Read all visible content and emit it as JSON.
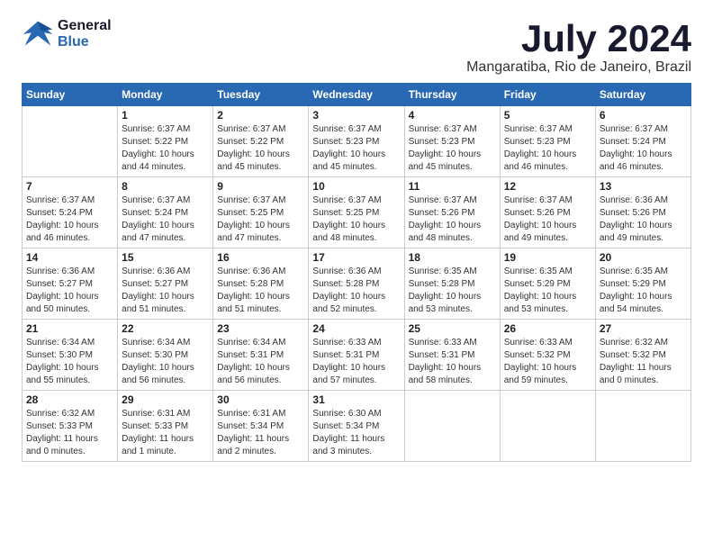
{
  "logo": {
    "line1": "General",
    "line2": "Blue"
  },
  "title": "July 2024",
  "subtitle": "Mangaratiba, Rio de Janeiro, Brazil",
  "headers": [
    "Sunday",
    "Monday",
    "Tuesday",
    "Wednesday",
    "Thursday",
    "Friday",
    "Saturday"
  ],
  "weeks": [
    [
      {
        "day": "",
        "info": ""
      },
      {
        "day": "1",
        "info": "Sunrise: 6:37 AM\nSunset: 5:22 PM\nDaylight: 10 hours\nand 44 minutes."
      },
      {
        "day": "2",
        "info": "Sunrise: 6:37 AM\nSunset: 5:22 PM\nDaylight: 10 hours\nand 45 minutes."
      },
      {
        "day": "3",
        "info": "Sunrise: 6:37 AM\nSunset: 5:23 PM\nDaylight: 10 hours\nand 45 minutes."
      },
      {
        "day": "4",
        "info": "Sunrise: 6:37 AM\nSunset: 5:23 PM\nDaylight: 10 hours\nand 45 minutes."
      },
      {
        "day": "5",
        "info": "Sunrise: 6:37 AM\nSunset: 5:23 PM\nDaylight: 10 hours\nand 46 minutes."
      },
      {
        "day": "6",
        "info": "Sunrise: 6:37 AM\nSunset: 5:24 PM\nDaylight: 10 hours\nand 46 minutes."
      }
    ],
    [
      {
        "day": "7",
        "info": "Sunrise: 6:37 AM\nSunset: 5:24 PM\nDaylight: 10 hours\nand 46 minutes."
      },
      {
        "day": "8",
        "info": "Sunrise: 6:37 AM\nSunset: 5:24 PM\nDaylight: 10 hours\nand 47 minutes."
      },
      {
        "day": "9",
        "info": "Sunrise: 6:37 AM\nSunset: 5:25 PM\nDaylight: 10 hours\nand 47 minutes."
      },
      {
        "day": "10",
        "info": "Sunrise: 6:37 AM\nSunset: 5:25 PM\nDaylight: 10 hours\nand 48 minutes."
      },
      {
        "day": "11",
        "info": "Sunrise: 6:37 AM\nSunset: 5:26 PM\nDaylight: 10 hours\nand 48 minutes."
      },
      {
        "day": "12",
        "info": "Sunrise: 6:37 AM\nSunset: 5:26 PM\nDaylight: 10 hours\nand 49 minutes."
      },
      {
        "day": "13",
        "info": "Sunrise: 6:36 AM\nSunset: 5:26 PM\nDaylight: 10 hours\nand 49 minutes."
      }
    ],
    [
      {
        "day": "14",
        "info": "Sunrise: 6:36 AM\nSunset: 5:27 PM\nDaylight: 10 hours\nand 50 minutes."
      },
      {
        "day": "15",
        "info": "Sunrise: 6:36 AM\nSunset: 5:27 PM\nDaylight: 10 hours\nand 51 minutes."
      },
      {
        "day": "16",
        "info": "Sunrise: 6:36 AM\nSunset: 5:28 PM\nDaylight: 10 hours\nand 51 minutes."
      },
      {
        "day": "17",
        "info": "Sunrise: 6:36 AM\nSunset: 5:28 PM\nDaylight: 10 hours\nand 52 minutes."
      },
      {
        "day": "18",
        "info": "Sunrise: 6:35 AM\nSunset: 5:28 PM\nDaylight: 10 hours\nand 53 minutes."
      },
      {
        "day": "19",
        "info": "Sunrise: 6:35 AM\nSunset: 5:29 PM\nDaylight: 10 hours\nand 53 minutes."
      },
      {
        "day": "20",
        "info": "Sunrise: 6:35 AM\nSunset: 5:29 PM\nDaylight: 10 hours\nand 54 minutes."
      }
    ],
    [
      {
        "day": "21",
        "info": "Sunrise: 6:34 AM\nSunset: 5:30 PM\nDaylight: 10 hours\nand 55 minutes."
      },
      {
        "day": "22",
        "info": "Sunrise: 6:34 AM\nSunset: 5:30 PM\nDaylight: 10 hours\nand 56 minutes."
      },
      {
        "day": "23",
        "info": "Sunrise: 6:34 AM\nSunset: 5:31 PM\nDaylight: 10 hours\nand 56 minutes."
      },
      {
        "day": "24",
        "info": "Sunrise: 6:33 AM\nSunset: 5:31 PM\nDaylight: 10 hours\nand 57 minutes."
      },
      {
        "day": "25",
        "info": "Sunrise: 6:33 AM\nSunset: 5:31 PM\nDaylight: 10 hours\nand 58 minutes."
      },
      {
        "day": "26",
        "info": "Sunrise: 6:33 AM\nSunset: 5:32 PM\nDaylight: 10 hours\nand 59 minutes."
      },
      {
        "day": "27",
        "info": "Sunrise: 6:32 AM\nSunset: 5:32 PM\nDaylight: 11 hours\nand 0 minutes."
      }
    ],
    [
      {
        "day": "28",
        "info": "Sunrise: 6:32 AM\nSunset: 5:33 PM\nDaylight: 11 hours\nand 0 minutes."
      },
      {
        "day": "29",
        "info": "Sunrise: 6:31 AM\nSunset: 5:33 PM\nDaylight: 11 hours\nand 1 minute."
      },
      {
        "day": "30",
        "info": "Sunrise: 6:31 AM\nSunset: 5:34 PM\nDaylight: 11 hours\nand 2 minutes."
      },
      {
        "day": "31",
        "info": "Sunrise: 6:30 AM\nSunset: 5:34 PM\nDaylight: 11 hours\nand 3 minutes."
      },
      {
        "day": "",
        "info": ""
      },
      {
        "day": "",
        "info": ""
      },
      {
        "day": "",
        "info": ""
      }
    ]
  ]
}
